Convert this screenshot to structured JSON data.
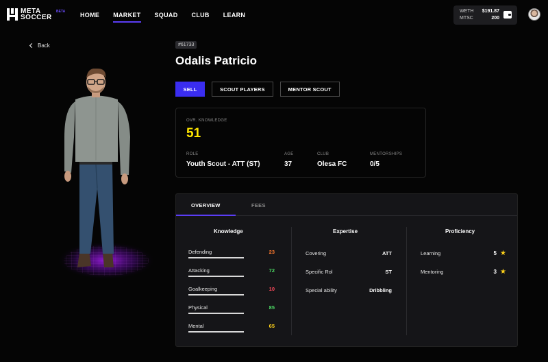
{
  "nav": {
    "logo_line1": "META",
    "logo_line2": "SOCCER",
    "beta": "BETA",
    "links": [
      "HOME",
      "MARKET",
      "SQUAD",
      "CLUB",
      "LEARN"
    ],
    "active_link": "MARKET",
    "wallet": {
      "row1_label": "WETH",
      "row1_value": "$191.87",
      "row2_label": "MTSC",
      "row2_value": "200"
    }
  },
  "back_label": "Back",
  "player": {
    "id": "#61733",
    "name": "Odalis Patricio"
  },
  "actions": {
    "sell": "SELL",
    "scout": "SCOUT PLAYERS",
    "mentor": "MENTOR SCOUT"
  },
  "stats": {
    "ovr_label": "OVR. KNOWLEDGE",
    "ovr_value": "51",
    "role_label": "ROLE",
    "role_value": "Youth Scout - ATT (ST)",
    "age_label": "AGE",
    "age_value": "37",
    "club_label": "CLUB",
    "club_value": "Olesa FC",
    "mentorships_label": "MENTORSHIPS",
    "mentorships_value": "0/5"
  },
  "tabs": [
    "OVERVIEW",
    "FEES"
  ],
  "knowledge": {
    "title": "Knowledge",
    "items": [
      {
        "label": "Defending",
        "value": "23",
        "color": "#ff7a2e",
        "fill": 1.0
      },
      {
        "label": "Attacking",
        "value": "72",
        "color": "#4cd964",
        "fill": 1.0
      },
      {
        "label": "Goalkeeping",
        "value": "10",
        "color": "#ff4b5c",
        "fill": 1.0
      },
      {
        "label": "Physical",
        "value": "85",
        "color": "#4cd964",
        "fill": 1.0
      },
      {
        "label": "Mental",
        "value": "65",
        "color": "#ffd21a",
        "fill": 1.0
      }
    ]
  },
  "expertise": {
    "title": "Expertise",
    "items": [
      {
        "label": "Covering",
        "value": "ATT"
      },
      {
        "label": "Specific Rol",
        "value": "ST"
      },
      {
        "label": "Special ability",
        "value": "Dribbling"
      }
    ]
  },
  "proficiency": {
    "title": "Proficiency",
    "items": [
      {
        "label": "Learning",
        "value": "5"
      },
      {
        "label": "Mentoring",
        "value": "3"
      }
    ]
  }
}
